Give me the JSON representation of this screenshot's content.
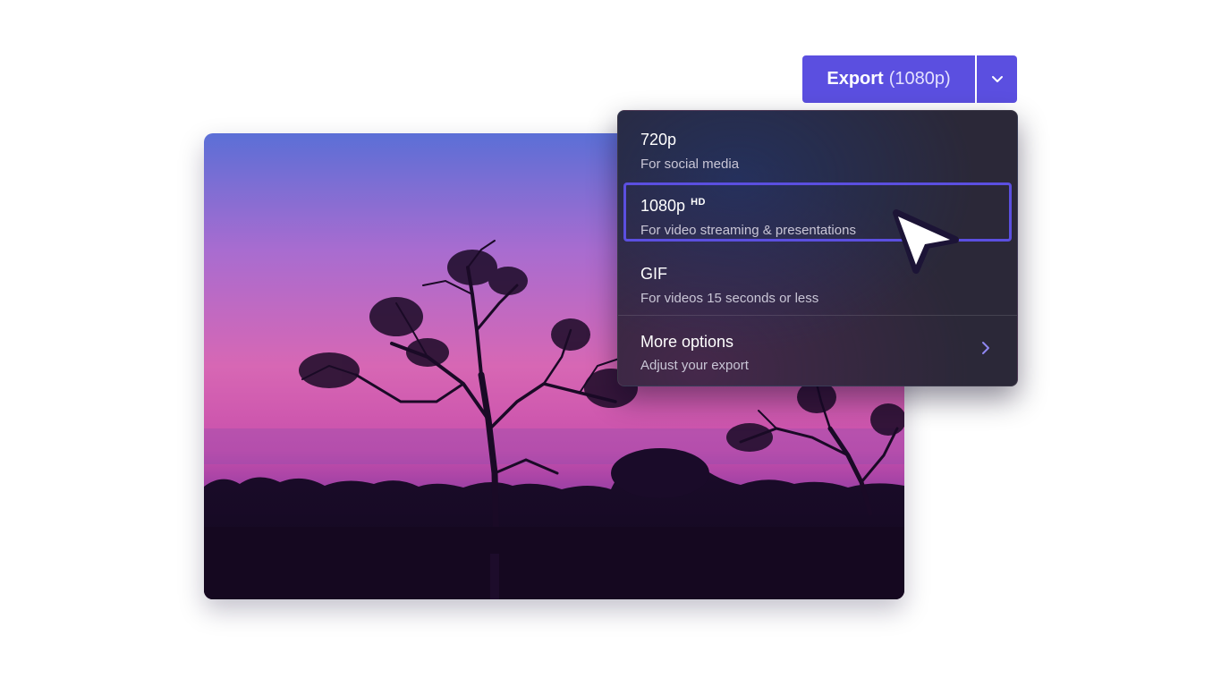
{
  "export_button": {
    "label": "Export",
    "resolution": "(1080p)"
  },
  "export_menu": {
    "items": [
      {
        "title": "720p",
        "subtitle": "For social media"
      },
      {
        "title": "1080p",
        "badge": "HD",
        "subtitle": "For video streaming & presentations",
        "selected": true
      },
      {
        "title": "GIF",
        "subtitle": "For videos 15 seconds or less"
      },
      {
        "title": "More options",
        "subtitle": "Adjust your export"
      }
    ]
  },
  "colors": {
    "accent": "#5b4fe0",
    "menu_background": "#2b2838",
    "sky_top": "#5b6fd6",
    "sky_mid": "#d767b4",
    "sky_low": "#9b3fa8"
  },
  "icons": {
    "dropdown": "chevron-down-icon",
    "more_options": "chevron-right-icon",
    "pointer": "mouse-pointer-icon"
  }
}
